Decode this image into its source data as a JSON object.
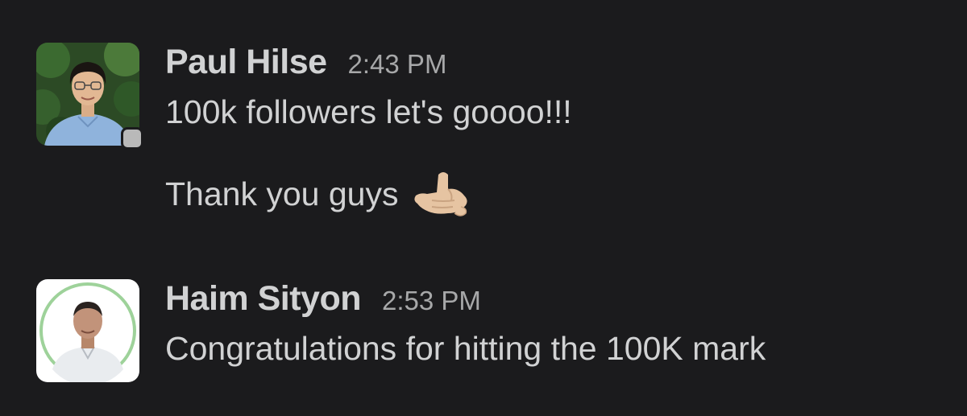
{
  "messages": [
    {
      "author": "Paul Hilse",
      "time": "2:43 PM",
      "lines": [
        "100k followers let's goooo!!!",
        "Thank you guys"
      ],
      "emoji": "call-me-hand-light-skin",
      "presence": "away"
    },
    {
      "author": "Haim Sityon",
      "time": "2:53 PM",
      "lines": [
        "Congratulations for hitting the 100K mark"
      ]
    }
  ],
  "colors": {
    "background": "#1b1b1d",
    "text": "#d1d2d3",
    "timestamp": "#a7a8a9",
    "presence_away": "#b9b9b9"
  }
}
